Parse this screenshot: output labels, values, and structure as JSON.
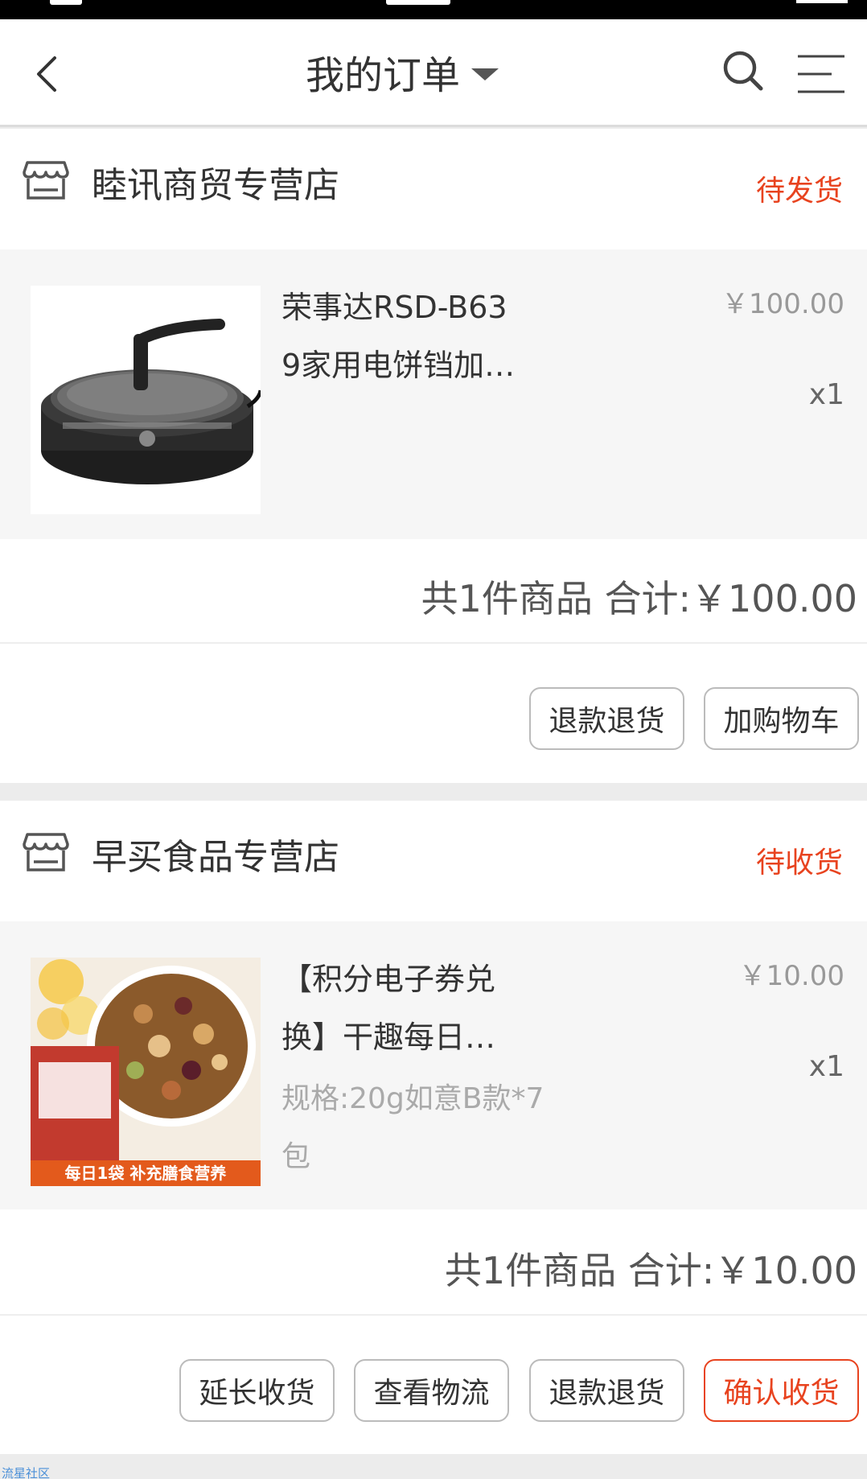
{
  "header": {
    "title": "我的订单"
  },
  "orders": [
    {
      "shop_name": "睦讯商贸专营店",
      "status": "待发货",
      "item": {
        "title_line1": "荣事达RSD-B63",
        "title_line2": "9家用电饼铛加…",
        "price": "￥100.00",
        "qty": "x1"
      },
      "summary": "共1件商品  合计:￥100.00",
      "buttons": [
        "退款退货",
        "加购物车"
      ]
    },
    {
      "shop_name": "早买食品专营店",
      "status": "待收货",
      "item": {
        "title_line1": "【积分电子券兑",
        "title_line2": "换】干趣每日…",
        "spec_line1": "规格:20g如意B款*7",
        "spec_line2": "包",
        "price": "￥10.00",
        "qty": "x1",
        "image_banner": "每日1袋 补充膳食营养"
      },
      "summary": "共1件商品  合计:￥10.00",
      "buttons": [
        "延长收货",
        "查看物流",
        "退款退货",
        "确认收货"
      ]
    }
  ],
  "watermark": "流星社区",
  "colors": {
    "accent": "#e8431f",
    "background": "#ececec",
    "item_bg": "#f6f6f6"
  }
}
